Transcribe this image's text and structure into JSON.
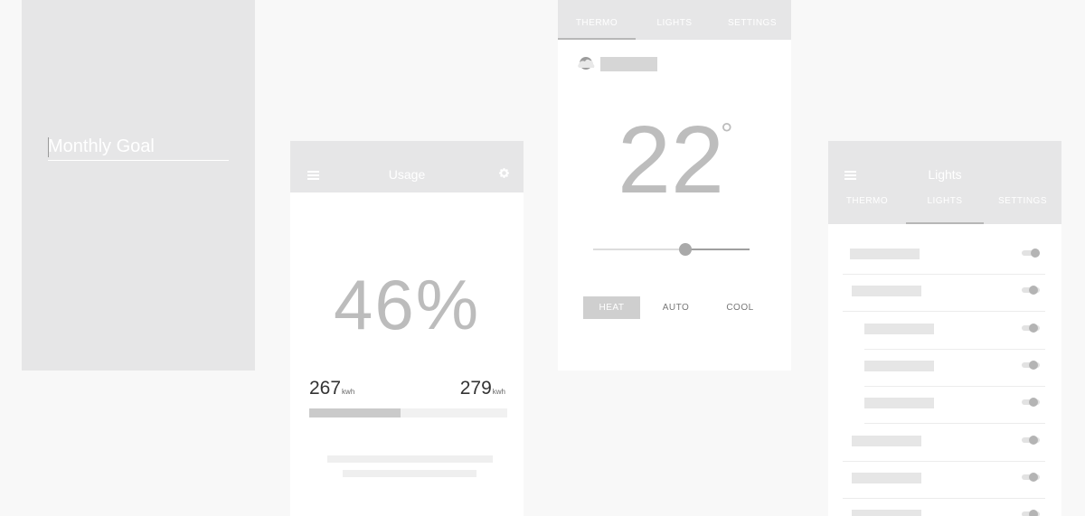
{
  "goal_panel": {
    "placeholder": "Monthly Goal"
  },
  "usage": {
    "title": "Usage",
    "menu_icon": "hamburger-icon",
    "settings_icon": "gear-icon",
    "percent": "46%",
    "current": "267",
    "current_unit": "kwh",
    "target": "279",
    "target_unit": "kwh",
    "progress": 0.46
  },
  "thermo": {
    "tabs": [
      {
        "label": "THERMO",
        "active": true
      },
      {
        "label": "LIGHTS",
        "active": false
      },
      {
        "label": "SETTINGS",
        "active": false
      }
    ],
    "weather_icon": "partly-cloudy-icon",
    "temperature": "22",
    "degree_symbol": "°",
    "slider_value": 0.6,
    "modes": [
      {
        "label": "HEAT",
        "active": true
      },
      {
        "label": "AUTO",
        "active": false
      },
      {
        "label": "COOL",
        "active": false
      }
    ]
  },
  "lights": {
    "title": "Lights",
    "menu_icon": "hamburger-icon",
    "tabs": [
      {
        "label": "THERMO",
        "active": false
      },
      {
        "label": "LIGHTS",
        "active": true
      },
      {
        "label": "SETTINGS",
        "active": false
      }
    ],
    "items": [
      {
        "on": true
      },
      {
        "on": false
      },
      {
        "on": false
      },
      {
        "on": false
      },
      {
        "on": false
      },
      {
        "on": false
      },
      {
        "on": false
      },
      {
        "on": false
      }
    ]
  },
  "colors": {
    "background": "#f8f8f8",
    "panel_header": "#e6e6e7",
    "accent_gray": "#bdbdbd",
    "text_dark": "#333333"
  }
}
